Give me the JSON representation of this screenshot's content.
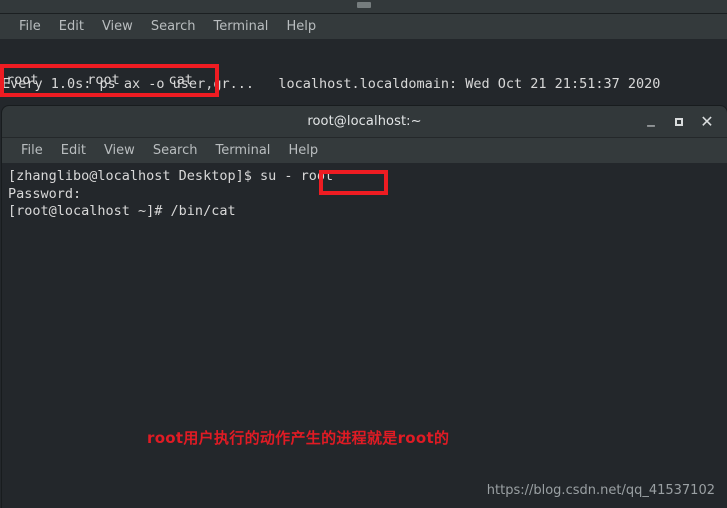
{
  "top_window": {
    "titlebar": {
      "nub": "drag-handle"
    },
    "menu": [
      "File",
      "Edit",
      "View",
      "Search",
      "Terminal",
      "Help"
    ],
    "watch_header": "Every 1.0s: ps ax -o user,gr...   localhost.localdomain: Wed Oct 21 21:51:37 2020",
    "ps_row": "root      root      cat"
  },
  "bottom_window": {
    "title": "root@localhost:~",
    "controls": {
      "minimize": "_",
      "maximize": "□",
      "close": "✕"
    },
    "menu": [
      "File",
      "Edit",
      "View",
      "Search",
      "Terminal",
      "Help"
    ],
    "terminal_lines": [
      "[zhanglibo@localhost Desktop]$ su - root",
      "Password:",
      "[root@localhost ~]# /bin/cat"
    ]
  },
  "annotation": {
    "text": "root用户执行的动作产生的进程就是root的",
    "color": "#e01b24"
  },
  "watermark": {
    "text": "https://blog.csdn.net/qq_41537102"
  },
  "highlights": [
    {
      "name": "ps-row-highlight",
      "color": "#ee1c22"
    },
    {
      "name": "su-root-highlight",
      "color": "#ee1c22"
    }
  ],
  "colors": {
    "terminal_bg": "#23272b",
    "menubar_bg": "#343a3c",
    "titlebar_bg": "#32383a",
    "text": "#d8d8d8",
    "menu_text": "#b9bdbf",
    "highlight_red": "#ee1c22",
    "annotation_red": "#e01b24",
    "watermark": "#9aa0a3"
  }
}
